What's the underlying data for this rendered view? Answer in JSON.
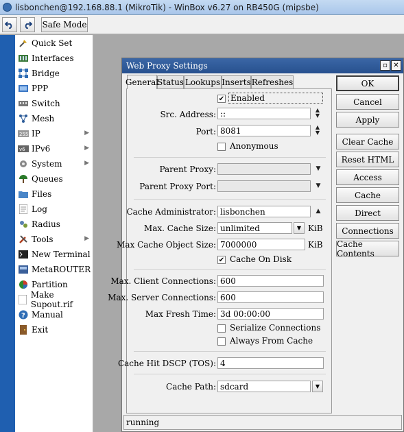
{
  "window": {
    "title": "lisbonchen@192.168.88.1 (MikroTik) - WinBox v6.27 on RB450G (mipsbe)"
  },
  "toolbar": {
    "undo_icon": "undo-icon",
    "redo_icon": "redo-icon",
    "safe_mode_label": "Safe Mode"
  },
  "sidebar": {
    "items": [
      {
        "label": "Quick Set",
        "icon": "quick-set-icon",
        "has_submenu": false
      },
      {
        "label": "Interfaces",
        "icon": "interfaces-icon",
        "has_submenu": false
      },
      {
        "label": "Bridge",
        "icon": "bridge-icon",
        "has_submenu": false
      },
      {
        "label": "PPP",
        "icon": "ppp-icon",
        "has_submenu": false
      },
      {
        "label": "Switch",
        "icon": "switch-icon",
        "has_submenu": false
      },
      {
        "label": "Mesh",
        "icon": "mesh-icon",
        "has_submenu": false
      },
      {
        "label": "IP",
        "icon": "ip-icon",
        "has_submenu": true
      },
      {
        "label": "IPv6",
        "icon": "ipv6-icon",
        "has_submenu": true
      },
      {
        "label": "System",
        "icon": "system-icon",
        "has_submenu": true
      },
      {
        "label": "Queues",
        "icon": "queues-icon",
        "has_submenu": false
      },
      {
        "label": "Files",
        "icon": "files-icon",
        "has_submenu": false
      },
      {
        "label": "Log",
        "icon": "log-icon",
        "has_submenu": false
      },
      {
        "label": "Radius",
        "icon": "radius-icon",
        "has_submenu": false
      },
      {
        "label": "Tools",
        "icon": "tools-icon",
        "has_submenu": true
      },
      {
        "label": "New Terminal",
        "icon": "terminal-icon",
        "has_submenu": false
      },
      {
        "label": "MetaROUTER",
        "icon": "metarouter-icon",
        "has_submenu": false
      },
      {
        "label": "Partition",
        "icon": "partition-icon",
        "has_submenu": false
      },
      {
        "label": "Make Supout.rif",
        "icon": "supout-icon",
        "has_submenu": false
      },
      {
        "label": "Manual",
        "icon": "manual-icon",
        "has_submenu": false
      },
      {
        "label": "Exit",
        "icon": "exit-icon",
        "has_submenu": false
      }
    ]
  },
  "dialog": {
    "title": "Web Proxy Settings",
    "tabs": [
      {
        "label": "General",
        "active": true
      },
      {
        "label": "Status",
        "active": false
      },
      {
        "label": "Lookups",
        "active": false
      },
      {
        "label": "Inserts",
        "active": false
      },
      {
        "label": "Refreshes",
        "active": false
      }
    ],
    "form": {
      "enabled": {
        "label": "Enabled",
        "checked": true
      },
      "src_address": {
        "label": "Src. Address:",
        "value": "::"
      },
      "port": {
        "label": "Port:",
        "value": "8081"
      },
      "anonymous": {
        "label": "Anonymous",
        "checked": false
      },
      "parent_proxy": {
        "label": "Parent Proxy:",
        "value": ""
      },
      "parent_proxy_port": {
        "label": "Parent Proxy Port:",
        "value": ""
      },
      "cache_administrator": {
        "label": "Cache Administrator:",
        "value": "lisbonchen"
      },
      "max_cache_size": {
        "label": "Max. Cache Size:",
        "value": "unlimited",
        "unit": "KiB"
      },
      "max_cache_object_size": {
        "label": "Max Cache Object Size:",
        "value": "7000000",
        "unit": "KiB"
      },
      "cache_on_disk": {
        "label": "Cache On Disk",
        "checked": true
      },
      "max_client_connections": {
        "label": "Max. Client Connections:",
        "value": "600"
      },
      "max_server_connections": {
        "label": "Max. Server Connections:",
        "value": "600"
      },
      "max_fresh_time": {
        "label": "Max Fresh Time:",
        "value": "3d 00:00:00"
      },
      "serialize_connections": {
        "label": "Serialize Connections",
        "checked": false
      },
      "always_from_cache": {
        "label": "Always From Cache",
        "checked": false
      },
      "cache_hit_dscp": {
        "label": "Cache Hit DSCP (TOS):",
        "value": "4"
      },
      "cache_path": {
        "label": "Cache Path:",
        "value": "sdcard"
      }
    },
    "buttons": {
      "ok": "OK",
      "cancel": "Cancel",
      "apply": "Apply",
      "clear_cache": "Clear Cache",
      "reset_html": "Reset HTML",
      "access": "Access",
      "cache": "Cache",
      "direct": "Direct",
      "connections": "Connections",
      "cache_contents": "Cache Contents"
    },
    "status": "running"
  }
}
